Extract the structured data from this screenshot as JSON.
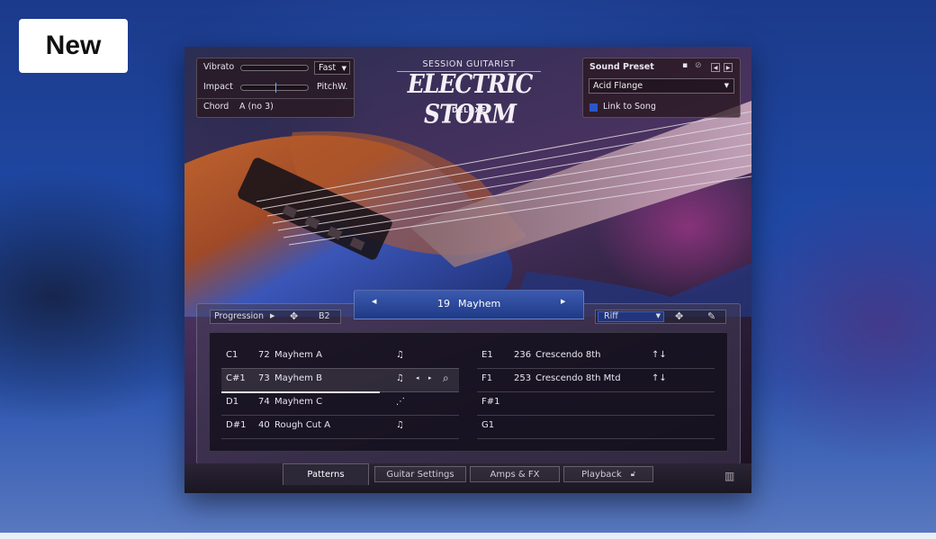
{
  "badge": "New",
  "plugin": {
    "logo": {
      "top": "SESSION GUITARIST",
      "main": "ELECTRIC STORM",
      "sub": "DELUXE"
    },
    "performance_panel": {
      "vibrato_label": "Vibrato",
      "vibrato_speed": "Fast",
      "impact_label": "Impact",
      "pitchwheel_label": "PitchW.",
      "chord_label": "Chord",
      "chord_value": "A (no 3)"
    },
    "sound_preset": {
      "label": "Sound Preset",
      "value": "Acid Flange",
      "link_label": "Link to Song"
    },
    "pattern_selector": {
      "number": "19",
      "name": "Mayhem"
    },
    "controls": {
      "progression_label": "Progression",
      "key_value": "B2",
      "mode_value": "Riff"
    },
    "patterns_left": [
      {
        "key": "C1",
        "num": "72",
        "name": "Mayhem A",
        "icon": "♫"
      },
      {
        "key": "C#1",
        "num": "73",
        "name": "Mayhem B",
        "icon": "♫"
      },
      {
        "key": "D1",
        "num": "74",
        "name": "Mayhem C",
        "icon": "⋰"
      },
      {
        "key": "D#1",
        "num": "40",
        "name": "Rough Cut A",
        "icon": "♫"
      }
    ],
    "patterns_right": [
      {
        "key": "E1",
        "num": "236",
        "name": "Crescendo 8th",
        "icon": "↑↓"
      },
      {
        "key": "F1",
        "num": "253",
        "name": "Crescendo 8th Mtd",
        "icon": "↑↓"
      },
      {
        "key": "F#1",
        "num": "",
        "name": "",
        "icon": ""
      },
      {
        "key": "G1",
        "num": "",
        "name": "",
        "icon": ""
      }
    ],
    "tabs": [
      "Patterns",
      "Guitar Settings",
      "Amps & FX",
      "Playback"
    ]
  },
  "colors": {
    "accent_blue": "#2b56c9",
    "header_blue": "#2f4fa3"
  }
}
